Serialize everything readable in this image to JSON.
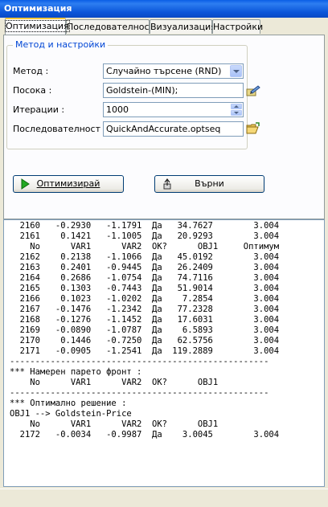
{
  "window": {
    "title": "Оптимизация"
  },
  "tabs": [
    {
      "label": "Оптимизация",
      "active": true
    },
    {
      "label": "Последователност",
      "active": false
    },
    {
      "label": "Визуализация",
      "active": false
    },
    {
      "label": "Настройки",
      "active": false
    }
  ],
  "group": {
    "legend": "Метод и настройки"
  },
  "form": {
    "method": {
      "label": "Метод :",
      "value": "Случайно търсене (RND)"
    },
    "direction": {
      "label": "Посока :",
      "value": "Goldstein-(MIN);"
    },
    "iterations": {
      "label": "Итерации :",
      "value": "1000"
    },
    "sequence": {
      "label": "Последователност :",
      "value": "QuickAndAccurate.optseq"
    }
  },
  "buttons": {
    "optimize": {
      "label": "Оптимизирай",
      "icon": "play-icon"
    },
    "back": {
      "label": "Върни",
      "icon": "undo-icon"
    }
  },
  "output": {
    "lines": [
      "  2160   -0.2930   -1.1791  Да   34.7627        3.004",
      "  2161    0.1421   -1.1005  Да   20.9293        3.004",
      "    No      VAR1      VAR2  OK?      OBJ1     Оптимум",
      "  2162    0.2138   -1.1066  Да   45.0192        3.004",
      "  2163    0.2401   -0.9445  Да   26.2409        3.004",
      "  2164    0.2686   -1.0754  Да   74.7116        3.004",
      "  2165    0.1303   -0.7443  Да   51.9014        3.004",
      "  2166    0.1023   -1.0202  Да    7.2854        3.004",
      "  2167   -0.1476   -1.2342  Да   77.2328        3.004",
      "  2168   -0.1276   -1.1452  Да   17.6031        3.004",
      "  2169   -0.0890   -1.0787  Да    6.5893        3.004",
      "  2170    0.1446   -0.7250  Да   62.5756        3.004",
      "  2171   -0.0905   -1.2541  Да  119.2889        3.004",
      "---------------------------------------------------",
      "*** Намерен парето фронт :",
      "    No      VAR1      VAR2  OK?      OBJ1",
      "---------------------------------------------------",
      "*** Оптимално решение :",
      "OBJ1 --> Goldstein-Price",
      "    No      VAR1      VAR2  OK?      OBJ1",
      "  2172   -0.0034   -0.9987  Да    3.0045        3.004"
    ]
  }
}
